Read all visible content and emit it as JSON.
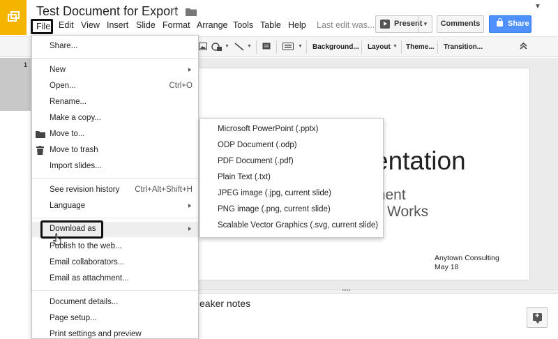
{
  "app": {
    "doc_title": "Test Document for Export",
    "logo_icon": "slides-logo-icon",
    "star_icon": "star-outline-icon",
    "folder_icon": "folder-icon"
  },
  "menubar": {
    "file": "File",
    "edit": "Edit",
    "view": "View",
    "insert": "Insert",
    "slide": "Slide",
    "format": "Format",
    "arrange": "Arrange",
    "tools": "Tools",
    "table": "Table",
    "help": "Help",
    "last_edit": "Last edit was..."
  },
  "header_buttons": {
    "present": "Present",
    "comments": "Comments",
    "share": "Share",
    "share_color": "#4d90fe"
  },
  "toolbar": {
    "background": "Background...",
    "layout": "Layout",
    "theme": "Theme...",
    "transition": "Transition..."
  },
  "file_menu": {
    "items": [
      {
        "label": "Share...",
        "shortcut": ""
      },
      {
        "label": "New",
        "shortcut": ""
      },
      {
        "label": "Open...",
        "shortcut": "Ctrl+O"
      },
      {
        "label": "Rename...",
        "shortcut": ""
      },
      {
        "label": "Make a copy...",
        "shortcut": ""
      },
      {
        "label": "Move to...",
        "shortcut": "",
        "icon": "folder-icon"
      },
      {
        "label": "Move to trash",
        "shortcut": "",
        "icon": "trash-icon"
      },
      {
        "label": "Import slides...",
        "shortcut": ""
      },
      {
        "label": "See revision history",
        "shortcut": "Ctrl+Alt+Shift+H"
      },
      {
        "label": "Language",
        "shortcut": ""
      },
      {
        "label": "Download as",
        "shortcut": ""
      },
      {
        "label": "Publish to the web...",
        "shortcut": ""
      },
      {
        "label": "Email collaborators...",
        "shortcut": ""
      },
      {
        "label": "Email as attachment...",
        "shortcut": ""
      },
      {
        "label": "Document details...",
        "shortcut": ""
      },
      {
        "label": "Page setup...",
        "shortcut": ""
      },
      {
        "label": "Print settings and preview",
        "shortcut": ""
      }
    ]
  },
  "download_submenu": {
    "items": [
      "Microsoft PowerPoint (.pptx)",
      "ODP Document (.odp)",
      "PDF Document (.pdf)",
      "Plain Text (.txt)",
      "JPEG image (.jpg, current slide)",
      "PNG image (.png, current slide)",
      "Scalable Vector Graphics (.svg, current slide)"
    ]
  },
  "slide": {
    "number": "1",
    "title_visible": "entation",
    "subtitle_line1_visible": "ment",
    "subtitle_line2_visible": "Works",
    "company": "Anytown Consulting",
    "date": "May 18"
  },
  "notes": {
    "placeholder_visible": "eaker notes"
  }
}
